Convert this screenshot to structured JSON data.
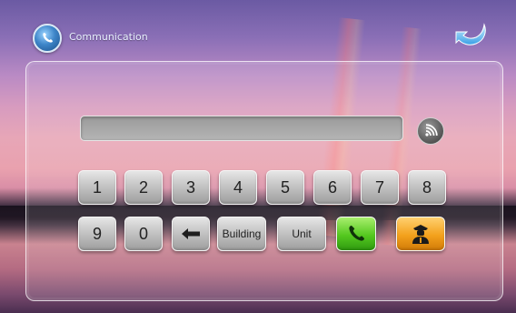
{
  "header": {
    "title": "Communication",
    "app_icon": "communication-icon",
    "back_icon": "back-arrow-icon"
  },
  "display": {
    "value": "",
    "rf_icon": "rf-signal-icon"
  },
  "keypad": {
    "row1": [
      "1",
      "2",
      "3",
      "4",
      "5",
      "6",
      "7",
      "8"
    ],
    "row2": [
      "9",
      "0"
    ],
    "backspace_icon": "backspace-arrow-icon",
    "building_label": "Building",
    "unit_label": "Unit",
    "call_icon": "phone-icon",
    "guard_icon": "security-guard-icon"
  },
  "colors": {
    "call": "#4cc41a",
    "guard": "#f39a17",
    "key": "#bdbdbd"
  }
}
